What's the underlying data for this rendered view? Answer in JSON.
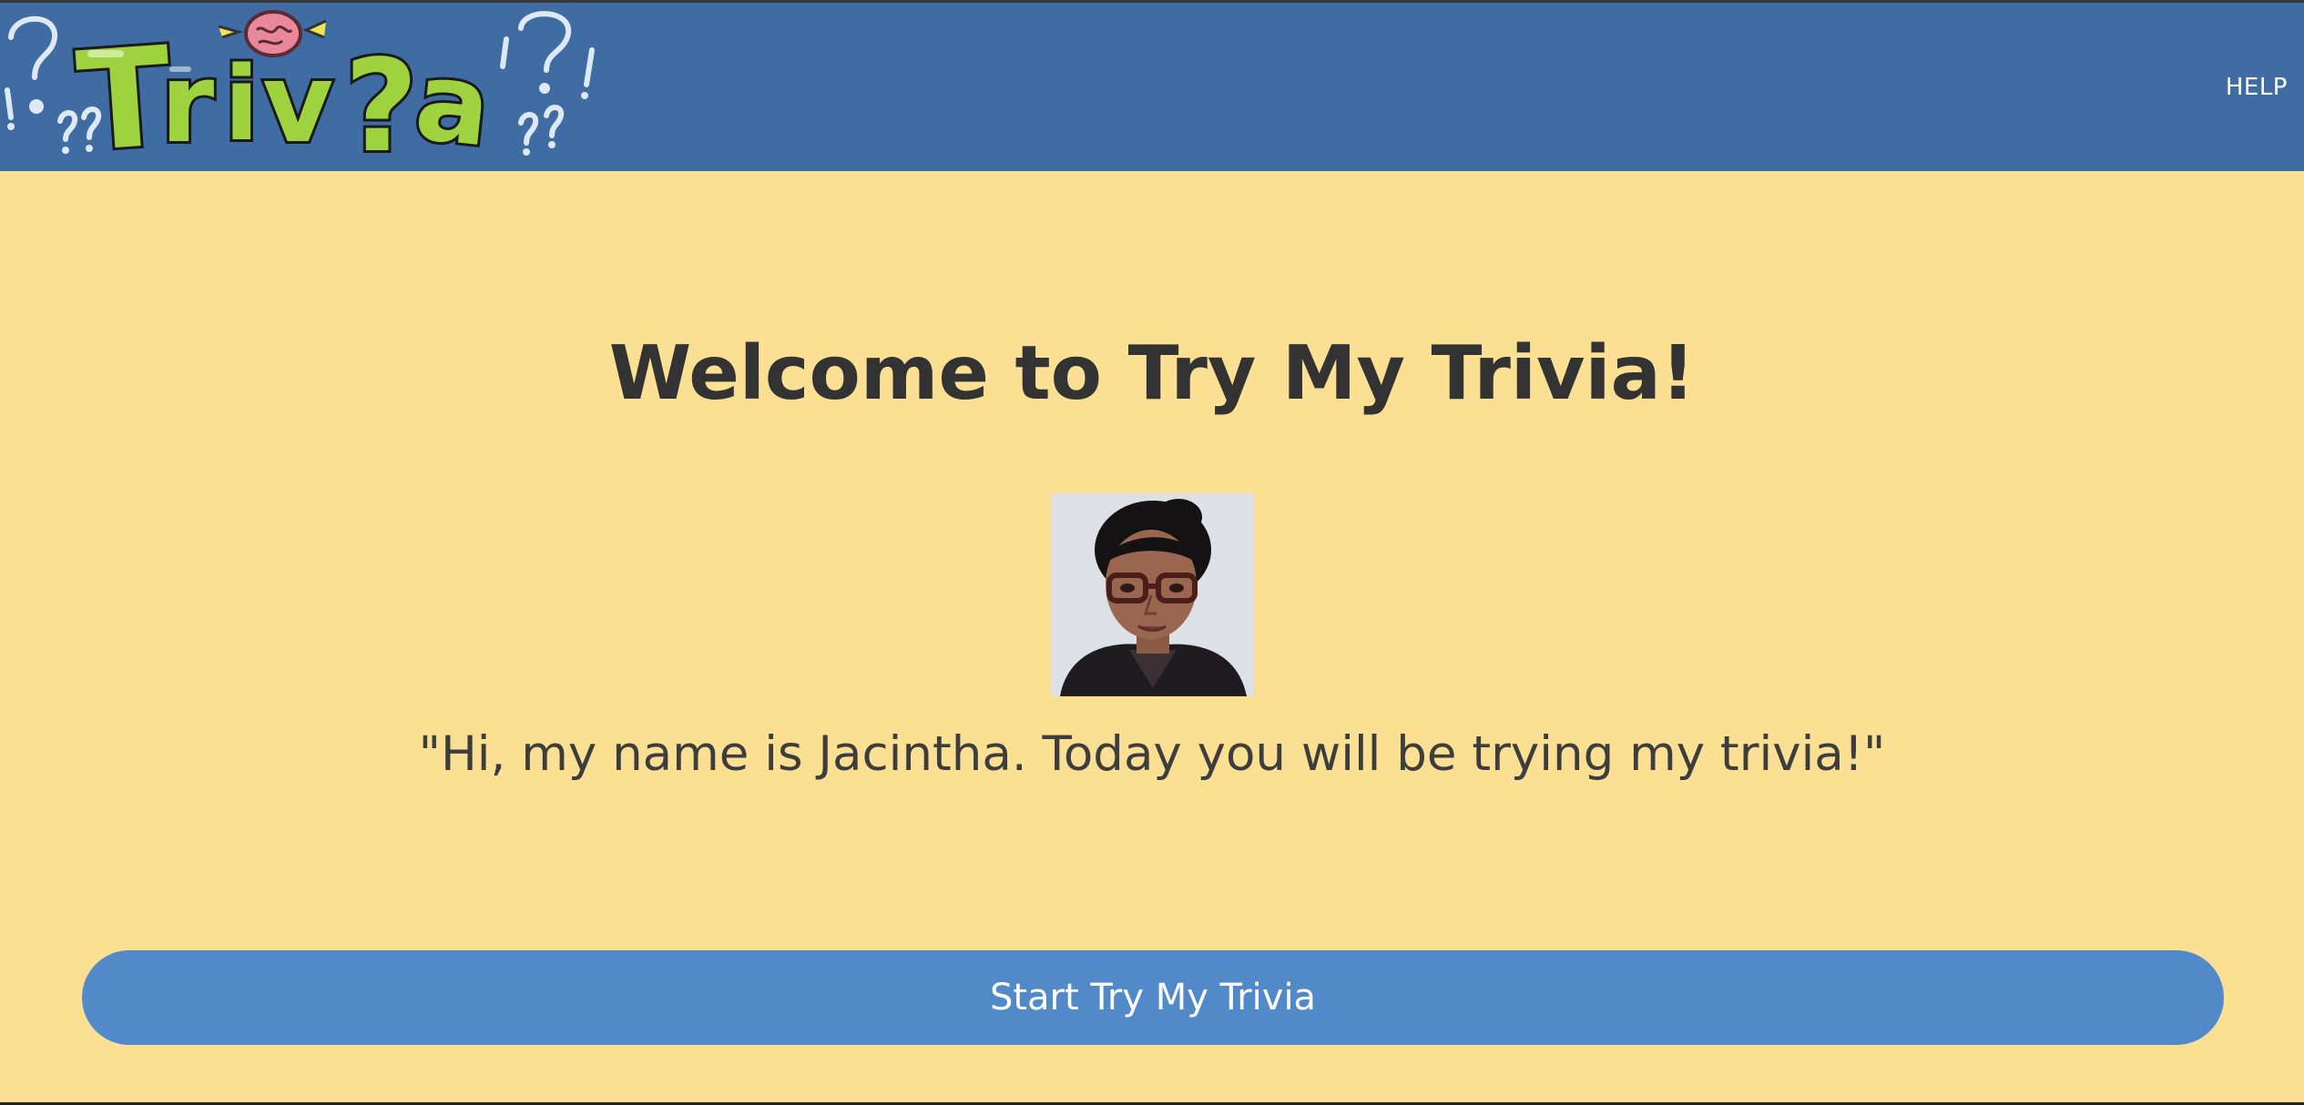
{
  "header": {
    "logo_text": "Triv?a",
    "help_label": "HELP",
    "background_color": "#3f6ca3"
  },
  "main": {
    "title": "Welcome to Try My Trivia!",
    "greeting": "\"Hi, my name is Jacintha. Today you will be trying my trivia!\"",
    "start_button_label": "Start Try My Trivia",
    "background_color": "#fbe094",
    "button_color": "#528ac9"
  },
  "icons": {
    "logo": "trivia-logo-icon",
    "avatar": "profile-photo"
  }
}
